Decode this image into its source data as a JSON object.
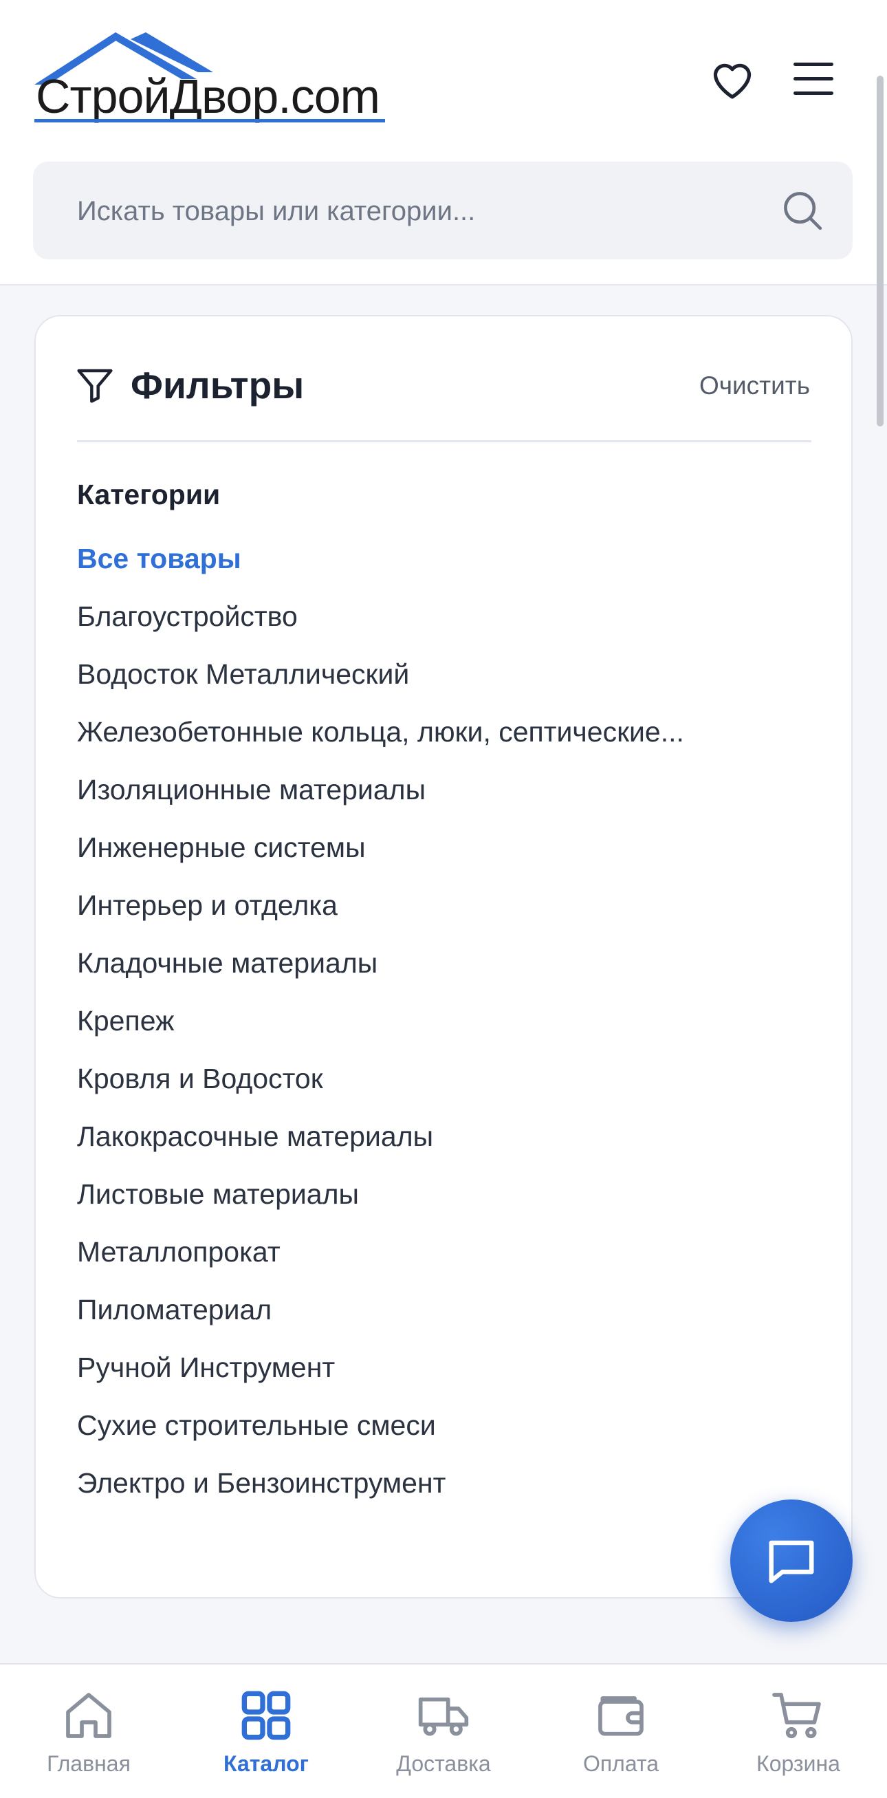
{
  "header": {
    "logo_text": "СтройДвор.com",
    "search_placeholder": "Искать товары или категории..."
  },
  "filters": {
    "title": "Фильтры",
    "clear_label": "Очистить",
    "section_title": "Категории",
    "categories": [
      {
        "label": "Все товары",
        "active": true
      },
      {
        "label": "Благоустройство"
      },
      {
        "label": "Водосток Металлический"
      },
      {
        "label": "Железобетонные кольца, люки, септические..."
      },
      {
        "label": "Изоляционные материалы"
      },
      {
        "label": "Инженерные системы"
      },
      {
        "label": "Интерьер и отделка"
      },
      {
        "label": "Кладочные материалы"
      },
      {
        "label": "Крепеж"
      },
      {
        "label": "Кровля и Водосток"
      },
      {
        "label": "Лакокрасочные материалы"
      },
      {
        "label": "Листовые материалы"
      },
      {
        "label": "Металлопрокат"
      },
      {
        "label": "Пиломатериал"
      },
      {
        "label": "Ручной Инструмент"
      },
      {
        "label": "Сухие строительные смеси"
      },
      {
        "label": "Электро и Бензоинструмент"
      }
    ]
  },
  "bottom_nav": [
    {
      "label": "Главная",
      "icon": "home-icon"
    },
    {
      "label": "Каталог",
      "icon": "grid-icon",
      "active": true
    },
    {
      "label": "Доставка",
      "icon": "truck-icon"
    },
    {
      "label": "Оплата",
      "icon": "wallet-icon"
    },
    {
      "label": "Корзина",
      "icon": "cart-icon"
    }
  ],
  "colors": {
    "accent": "#2f6fd6",
    "background": "#f5f6f9",
    "text": "#2b3240",
    "muted": "#8a909c"
  }
}
